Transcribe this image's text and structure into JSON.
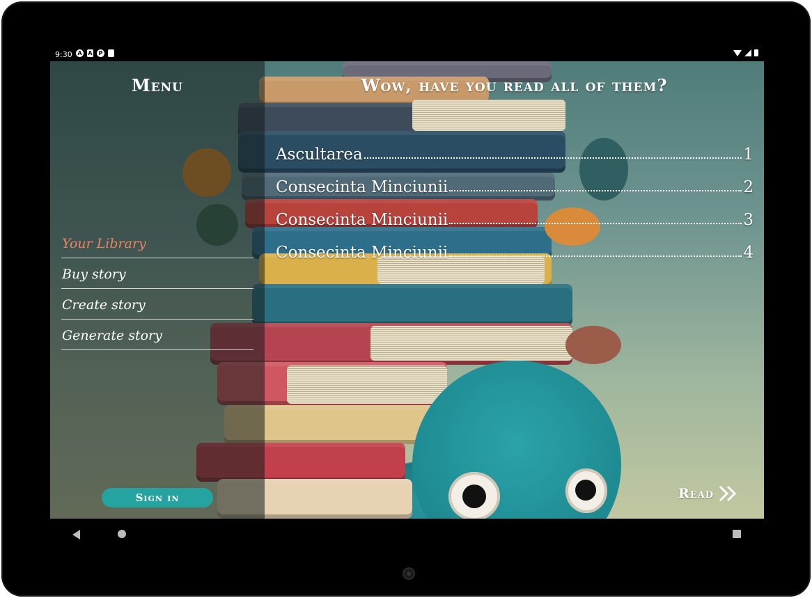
{
  "status_bar": {
    "time": "9:30",
    "left_icons": [
      "A",
      "A",
      "P",
      ""
    ],
    "right_icons": [
      "wifi-icon",
      "signal-icon",
      "battery-icon"
    ]
  },
  "menu": {
    "title": "Menu",
    "items": [
      {
        "label": "Your Library",
        "active": true
      },
      {
        "label": "Buy story",
        "active": false
      },
      {
        "label": "Create story",
        "active": false
      },
      {
        "label": "Generate story",
        "active": false
      }
    ],
    "sign_in_label": "Sign in"
  },
  "main": {
    "title": "Wow, have you read all of them?",
    "stories": [
      {
        "title": "Ascultarea",
        "page": "1"
      },
      {
        "title": "Consecinta Minciunii",
        "page": "2"
      },
      {
        "title": "Consecinta Minciunii",
        "page": "3"
      },
      {
        "title": "Consecinta Minciunii",
        "page": "4"
      }
    ],
    "read_label": "Read"
  },
  "colors": {
    "accent_teal": "#25a3a0",
    "active_menu": "#e88462",
    "text": "#ffffff"
  }
}
